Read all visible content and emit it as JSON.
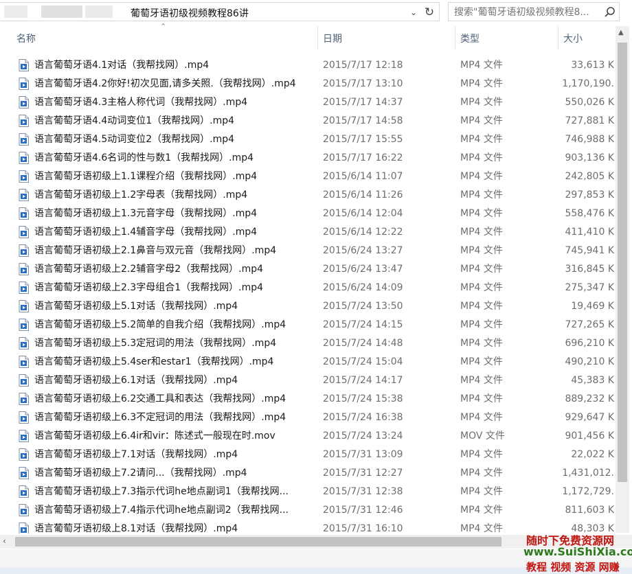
{
  "address_bar": {
    "path": "葡萄牙语初级视频教程86讲"
  },
  "search": {
    "placeholder": "搜索\"葡萄牙语初级视频教程8...",
    "icon": "search-icon"
  },
  "columns": {
    "name": "名称",
    "date": "日期",
    "type": "类型",
    "size": "大小"
  },
  "files": [
    {
      "name": "语言葡萄牙语4.1对话（我帮找网）.mp4",
      "date": "2015/7/17 12:18",
      "type": "MP4 文件",
      "size": "33,613 K"
    },
    {
      "name": "语言葡萄牙语4.2你好!初次见面,请多关照.（我帮找网）.mp4",
      "date": "2015/7/17 13:10",
      "type": "MP4 文件",
      "size": "1,170,190."
    },
    {
      "name": "语言葡萄牙语4.3主格人称代词（我帮找网）.mp4",
      "date": "2015/7/17 14:37",
      "type": "MP4 文件",
      "size": "550,026 K"
    },
    {
      "name": "语言葡萄牙语4.4动词变位1（我帮找网）.mp4",
      "date": "2015/7/17 14:58",
      "type": "MP4 文件",
      "size": "727,881 K"
    },
    {
      "name": "语言葡萄牙语4.5动词变位2（我帮找网）.mp4",
      "date": "2015/7/17 15:55",
      "type": "MP4 文件",
      "size": "746,988 K"
    },
    {
      "name": "语言葡萄牙语4.6名词的性与数1（我帮找网）.mp4",
      "date": "2015/7/17 16:22",
      "type": "MP4 文件",
      "size": "903,136 K"
    },
    {
      "name": "语言葡萄牙语初级上1.1课程介绍（我帮找网）.mp4",
      "date": "2015/6/14 11:07",
      "type": "MP4 文件",
      "size": "242,805 K"
    },
    {
      "name": "语言葡萄牙语初级上1.2字母表（我帮找网）.mp4",
      "date": "2015/6/14 11:26",
      "type": "MP4 文件",
      "size": "297,853 K"
    },
    {
      "name": "语言葡萄牙语初级上1.3元音字母（我帮找网）.mp4",
      "date": "2015/6/14 12:04",
      "type": "MP4 文件",
      "size": "558,476 K"
    },
    {
      "name": "语言葡萄牙语初级上1.4辅音字母（我帮找网）.mp4",
      "date": "2015/6/14 12:22",
      "type": "MP4 文件",
      "size": "411,410 K"
    },
    {
      "name": "语言葡萄牙语初级上2.1鼻音与双元音（我帮找网）.mp4",
      "date": "2015/6/24 13:27",
      "type": "MP4 文件",
      "size": "745,941 K"
    },
    {
      "name": "语言葡萄牙语初级上2.2辅音字母2（我帮找网）.mp4",
      "date": "2015/6/24 13:47",
      "type": "MP4 文件",
      "size": "316,845 K"
    },
    {
      "name": "语言葡萄牙语初级上2.3字母组合1（我帮找网）.mp4",
      "date": "2015/6/24 14:09",
      "type": "MP4 文件",
      "size": "275,347 K"
    },
    {
      "name": "语言葡萄牙语初级上5.1对话（我帮找网）.mp4",
      "date": "2015/7/24 13:50",
      "type": "MP4 文件",
      "size": "19,469 K"
    },
    {
      "name": "语言葡萄牙语初级上5.2简单的自我介绍（我帮找网）.mp4",
      "date": "2015/7/24 14:15",
      "type": "MP4 文件",
      "size": "727,265 K"
    },
    {
      "name": "语言葡萄牙语初级上5.3定冠词的用法（我帮找网）.mp4",
      "date": "2015/7/24 14:48",
      "type": "MP4 文件",
      "size": "696,210 K"
    },
    {
      "name": "语言葡萄牙语初级上5.4ser和estar1（我帮找网）.mp4",
      "date": "2015/7/24 15:04",
      "type": "MP4 文件",
      "size": "490,210 K"
    },
    {
      "name": "语言葡萄牙语初级上6.1对话（我帮找网）.mp4",
      "date": "2015/7/24 14:17",
      "type": "MP4 文件",
      "size": "45,383 K"
    },
    {
      "name": "语言葡萄牙语初级上6.2交通工具和表达（我帮找网）.mp4",
      "date": "2015/7/24 15:38",
      "type": "MP4 文件",
      "size": "889,232 K"
    },
    {
      "name": "语言葡萄牙语初级上6.3不定冠词的用法（我帮找网）.mp4",
      "date": "2015/7/24 16:38",
      "type": "MP4 文件",
      "size": "929,647 K"
    },
    {
      "name": "语言葡萄牙语初级上6.4ir和vir：陈述式一般现在时.mov",
      "date": "2015/7/24 13:24",
      "type": "MOV 文件",
      "size": "901,456 K"
    },
    {
      "name": "语言葡萄牙语初级上7.1对话（我帮找网）.mp4",
      "date": "2015/7/31 13:09",
      "type": "MP4 文件",
      "size": "22,022 K"
    },
    {
      "name": "语言葡萄牙语初级上7.2请问...（我帮找网）.mp4",
      "date": "2015/7/31 12:27",
      "type": "MP4 文件",
      "size": "1,431,012."
    },
    {
      "name": "语言葡萄牙语初级上7.3指示代词he地点副词1（我帮找网...",
      "date": "2015/7/31 12:38",
      "type": "MP4 文件",
      "size": "1,172,729."
    },
    {
      "name": "语言葡萄牙语初级上7.4指示代词he地点副词2（我帮找网...",
      "date": "2015/7/31 12:46",
      "type": "MP4 文件",
      "size": "811,603 K"
    },
    {
      "name": "语言葡萄牙语初级上8.1对话（我帮找网）.mp4",
      "date": "2015/7/31 16:10",
      "type": "MP4 文件",
      "size": "48,303 K"
    }
  ],
  "watermark": {
    "line1": "随时下免费资源网",
    "line2": "www.SuiShiXia.com",
    "line3": "教程 视频 资源 网赚"
  },
  "colors": {
    "header_text": "#4c607a",
    "muted_text": "#6d6d6d",
    "watermark_red": "#c2140e",
    "watermark_green": "#2d7a1e"
  }
}
